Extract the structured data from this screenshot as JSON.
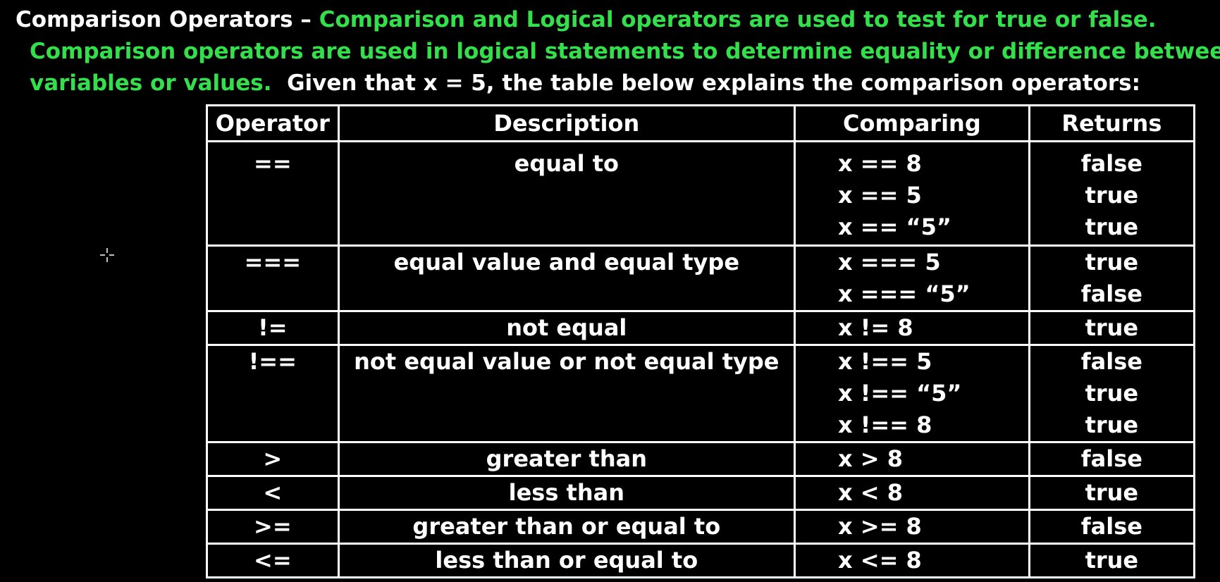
{
  "intro": {
    "heading": "Comparison Operators – ",
    "green_line1": "Comparison and Logical operators are used to test for true or false.",
    "green_line2": "Comparison operators are used in logical statements to determine equality or difference between",
    "green_line3": "variables or values.",
    "white_line3": "Given that x = 5, the table below explains the comparison operators:"
  },
  "table": {
    "headers": {
      "operator": "Operator",
      "description": "Description",
      "comparing": "Comparing",
      "returns": "Returns"
    },
    "rows": [
      {
        "operator": "==",
        "description": "equal to",
        "comparisons": [
          "x == 8",
          "x == 5",
          "x == “5”"
        ],
        "returns": [
          "false",
          "true",
          "true"
        ]
      },
      {
        "operator": "===",
        "description": "equal value and equal type",
        "comparisons": [
          "x === 5",
          "x === “5”"
        ],
        "returns": [
          "true",
          "false"
        ]
      },
      {
        "operator": "!=",
        "description": "not equal",
        "comparisons": [
          "x != 8"
        ],
        "returns": [
          "true"
        ]
      },
      {
        "operator": "!==",
        "description": "not equal value or not equal type",
        "comparisons": [
          "x !== 5",
          "x !== “5”",
          "x !== 8"
        ],
        "returns": [
          "false",
          "true",
          "true"
        ]
      },
      {
        "operator": ">",
        "description": "greater than",
        "comparisons": [
          "x > 8"
        ],
        "returns": [
          "false"
        ]
      },
      {
        "operator": "<",
        "description": "less than",
        "comparisons": [
          "x < 8"
        ],
        "returns": [
          "true"
        ]
      },
      {
        "operator": ">=",
        "description": "greater than or equal to",
        "comparisons": [
          "x >= 8"
        ],
        "returns": [
          "false"
        ]
      },
      {
        "operator": "<=",
        "description": "less than or equal to",
        "comparisons": [
          "x <= 8"
        ],
        "returns": [
          "true"
        ]
      }
    ]
  },
  "colors": {
    "background": "#000000",
    "text": "#ffffff",
    "accent_green": "#33e04b",
    "border": "#ffffff"
  },
  "icons": {
    "cursor": "crosshair-cursor-icon"
  }
}
